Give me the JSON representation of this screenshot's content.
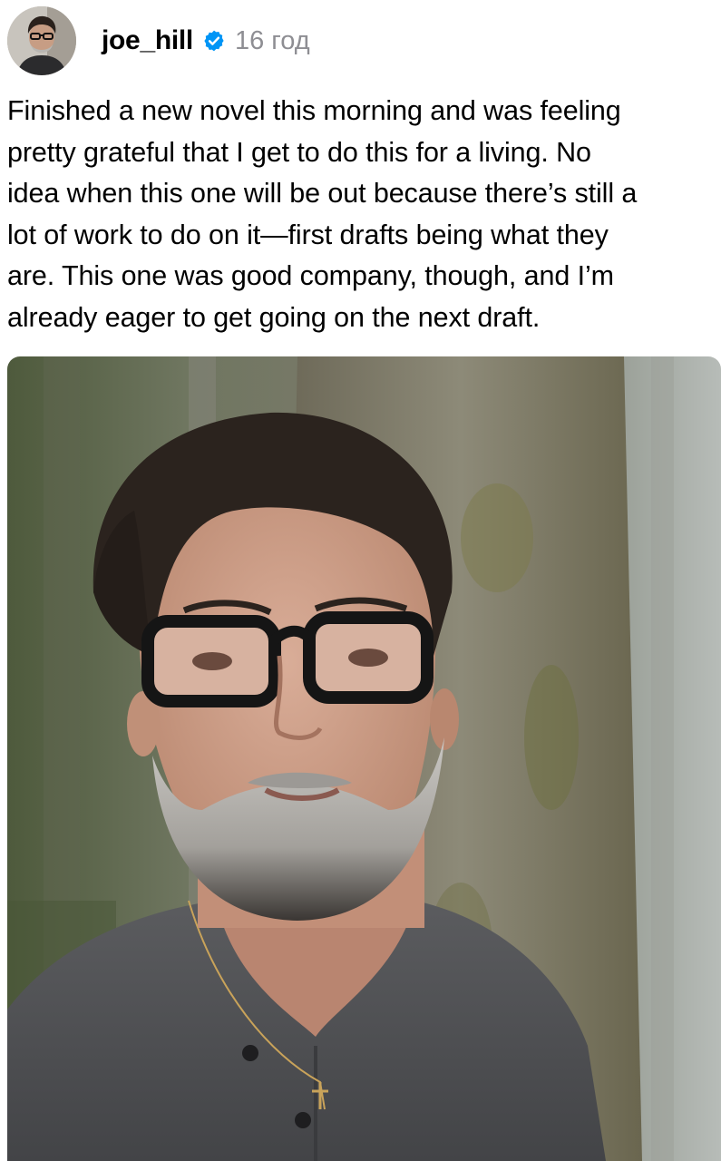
{
  "post": {
    "username": "joe_hill",
    "verified": true,
    "time": "16 год",
    "caption": "Finished a new novel this morning and was feeling\npretty grateful that I get to do this for a living. No\nidea when this one will be out because there’s still a\nlot of work to do on it—first drafts being what they\nare. This one was good company, though, and I’m\nalready eager to get going on the next draft."
  },
  "icons": {
    "verified": "verified-badge-icon"
  },
  "colors": {
    "verified_blue": "#0095f6",
    "meta_gray": "#8e8e93"
  }
}
